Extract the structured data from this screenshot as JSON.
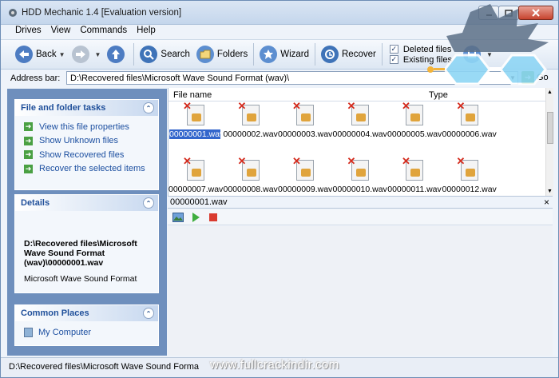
{
  "window": {
    "title": "HDD Mechanic 1.4 [Evaluation version]"
  },
  "menu": [
    "Drives",
    "View",
    "Commands",
    "Help"
  ],
  "toolbar": {
    "back": "Back",
    "search": "Search",
    "folders": "Folders",
    "wizard": "Wizard",
    "recover": "Recover",
    "deleted_files": "Deleted files",
    "existing_files": "Existing files",
    "deleted_checked": true,
    "existing_checked": true
  },
  "address": {
    "label": "Address bar:",
    "value": "D:\\Recovered files\\Microsoft Wave Sound Format (wav)\\",
    "go": "Go"
  },
  "tasks_panel": {
    "title": "File and folder tasks",
    "items": [
      "View this file properties",
      "Show Unknown files",
      "Show Recovered files",
      "Recover the selected items"
    ]
  },
  "details_panel": {
    "title": "Details",
    "path": "D:\\Recovered files\\Microsoft Wave Sound Format (wav)\\00000001.wav",
    "type": "Microsoft Wave Sound Format"
  },
  "places_panel": {
    "title": "Common Places",
    "items": [
      "My Computer"
    ]
  },
  "file_list": {
    "columns": [
      "File name",
      "Type"
    ],
    "files": [
      "00000001.wav",
      "00000002.wav",
      "00000003.wav",
      "00000004.wav",
      "00000005.wav",
      "00000006.wav",
      "00000007.wav",
      "00000008.wav",
      "00000009.wav",
      "00000010.wav",
      "00000011.wav",
      "00000012.wav"
    ],
    "selected": "00000001.wav"
  },
  "preview": {
    "file": "00000001.wav"
  },
  "status": {
    "text": "D:\\Recovered files\\Microsoft Wave Sound Forma"
  },
  "watermark": "www.fullcrackindir.com",
  "colors": {
    "link": "#1c4fa0",
    "panel_title": "#1f4f9a",
    "selection": "#3366cc",
    "left_pane": "#6e8fbd"
  }
}
